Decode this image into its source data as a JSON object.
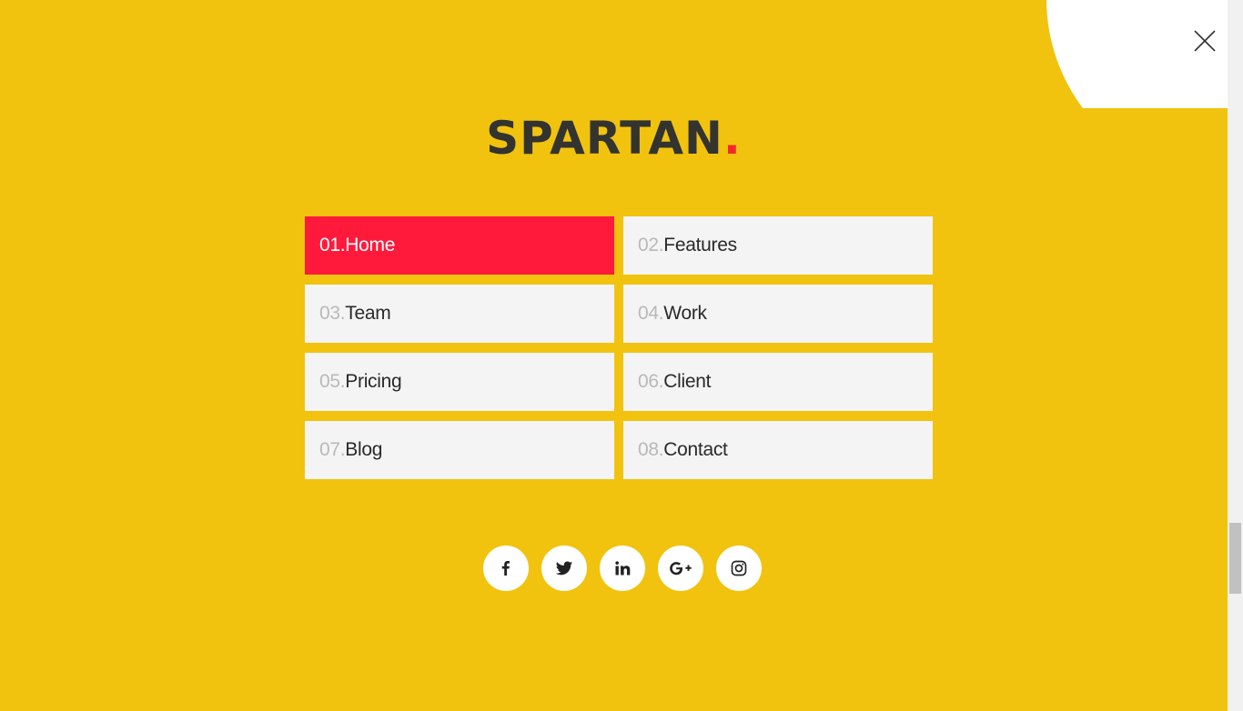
{
  "logo": {
    "text": "SPARTAN",
    "dot": "."
  },
  "menu": [
    {
      "num": "01.",
      "label": "Home",
      "active": true
    },
    {
      "num": "02.",
      "label": "Features",
      "active": false
    },
    {
      "num": "03.",
      "label": "Team",
      "active": false
    },
    {
      "num": "04.",
      "label": "Work",
      "active": false
    },
    {
      "num": "05.",
      "label": "Pricing",
      "active": false
    },
    {
      "num": "06.",
      "label": "Client",
      "active": false
    },
    {
      "num": "07.",
      "label": "Blog",
      "active": false
    },
    {
      "num": "08.",
      "label": "Contact",
      "active": false
    }
  ],
  "social": [
    {
      "icon": "facebook-icon"
    },
    {
      "icon": "twitter-icon"
    },
    {
      "icon": "linkedin-icon"
    },
    {
      "icon": "google-plus-icon"
    },
    {
      "icon": "instagram-icon"
    }
  ],
  "colors": {
    "background": "#f1c30e",
    "accent": "#ff1a3c",
    "logo_dot": "#f2292b",
    "tile": "#f4f4f4"
  }
}
